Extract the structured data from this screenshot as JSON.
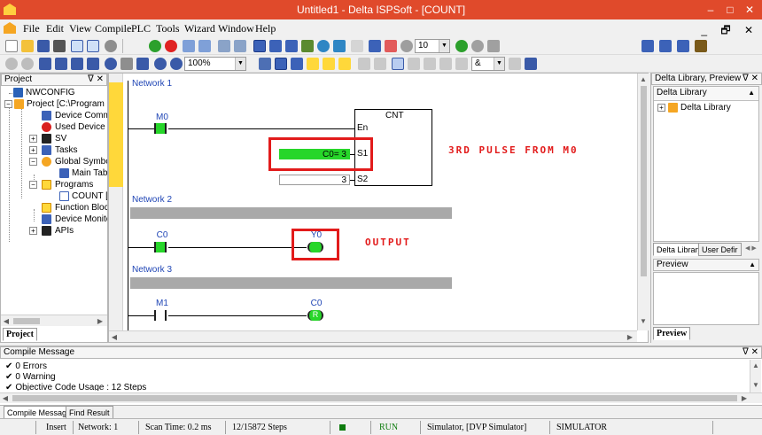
{
  "window": {
    "title": "Untitled1 - Delta ISPSoft - [COUNT]",
    "min_glyph": "–",
    "max_glyph": "□",
    "close_glyph": "✕",
    "accent": "#e04a2b"
  },
  "menu": {
    "items": [
      "File",
      "Edit",
      "View",
      "Compile",
      "PLC",
      "Tools",
      "Wizard",
      "Window",
      "Help"
    ],
    "mdi_controls": "_ 🗗 ✕"
  },
  "toolbar": {
    "step_value": "10",
    "zoom": "100%",
    "combo_value": "&"
  },
  "project_panel": {
    "title": "Project",
    "pin_glyph": "ᐁ ✕",
    "tab_label": "Project",
    "tree": [
      {
        "label": "NWCONFIG"
      },
      {
        "label": "Project [C:\\Program"
      },
      {
        "label": "Device Comme"
      },
      {
        "label": "Used Device R"
      },
      {
        "label": "SV"
      },
      {
        "label": "Tasks"
      },
      {
        "label": "Global Symbol"
      },
      {
        "label": "Main Tabl"
      },
      {
        "label": "Programs"
      },
      {
        "label": "COUNT [F"
      },
      {
        "label": "Function Block"
      },
      {
        "label": "Device Monitor"
      },
      {
        "label": "APIs"
      }
    ]
  },
  "editor": {
    "networks": [
      {
        "label": "Network 1"
      },
      {
        "label": "Network 2"
      },
      {
        "label": "Network 3"
      }
    ],
    "n1": {
      "contact_label": "M0",
      "block_title": "CNT",
      "pin_en": "En",
      "pin_s1": "S1",
      "pin_s2": "S2",
      "s1_value": "C0= 3",
      "s2_value": "3",
      "annotation": "3RD PULSE FROM M0"
    },
    "n2": {
      "contact_label": "C0",
      "coil_label": "Y0",
      "annotation": "OUTPUT"
    },
    "n3": {
      "contact_label": "M1",
      "coil_label": "C0",
      "coil_text": "R"
    }
  },
  "library_panel": {
    "title": "Delta Library, Preview",
    "pin_glyph": "ᐁ ✕",
    "dropdown": "Delta Library",
    "tree_item": "Delta Library",
    "tabs": [
      "Delta Library",
      "User Defir"
    ],
    "tab_arrows": "◀ ▶",
    "preview_title": "Preview",
    "preview_tab": "Preview"
  },
  "compile_panel": {
    "title": "Compile Message",
    "pin_glyph": "ᐁ ✕",
    "lines": [
      "0 Errors",
      "0 Warning",
      "Objective Code Usage : 12 Steps"
    ],
    "check_glyph": "✔"
  },
  "bottom_tabs": [
    "Compile Message",
    "Find Result"
  ],
  "status": {
    "mode": "Insert",
    "network": "Network: 1",
    "scan": "Scan Time: 0.2 ms",
    "steps": "12/15872 Steps",
    "run": "RUN",
    "simulator": "Simulator, [DVP Simulator]",
    "sim_label": "SIMULATOR",
    "run_color": "#0f7c0f"
  },
  "colors": {
    "energized": "#27d62a",
    "annotation": "#e21b1b",
    "network_label": "#1f45b5"
  }
}
